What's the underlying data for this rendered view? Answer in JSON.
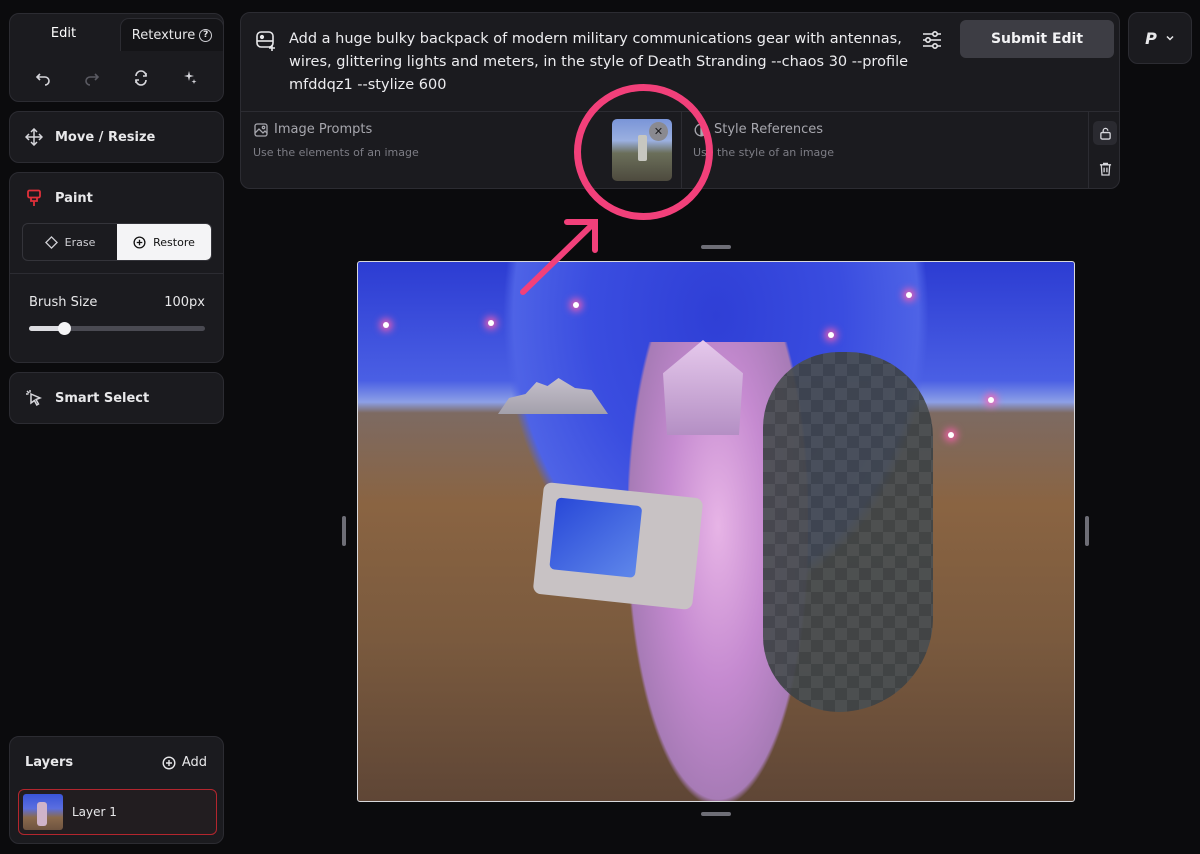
{
  "tabs": {
    "edit": "Edit",
    "retexture": "Retexture"
  },
  "tools": {
    "move": "Move / Resize",
    "paint": "Paint",
    "smart_select": "Smart Select"
  },
  "paint": {
    "erase": "Erase",
    "restore": "Restore",
    "brush_label": "Brush Size",
    "brush_value": "100px",
    "brush_fraction": 0.2
  },
  "layers": {
    "title": "Layers",
    "add": "Add",
    "items": [
      {
        "label": "Layer 1"
      }
    ]
  },
  "prompt": {
    "text": "Add a huge bulky backpack of modern military communications gear with antennas, wires, glittering lights and meters, in the style of Death Stranding --chaos 30 --profile mfddqz1 --stylize 600",
    "submit": "Submit Edit"
  },
  "image_prompts": {
    "title": "Image Prompts",
    "subtitle": "Use the elements of an image"
  },
  "style_references": {
    "title": "Style References",
    "subtitle": "Use the style of an image"
  },
  "profile": {
    "letter": "P"
  },
  "colors": {
    "accent": "#f2407a",
    "paint_icon": "#e0303a",
    "layer_border": "#b3262e"
  },
  "icons": [
    "undo-icon",
    "redo-icon",
    "refresh-icon",
    "sparkle-icon",
    "move-icon",
    "paint-icon",
    "eraser-icon",
    "plus-circle-icon",
    "cursor-select-icon",
    "settings-sliders-icon",
    "image-icon",
    "style-icon",
    "lock-icon",
    "trash-icon",
    "chevron-down-icon",
    "close-icon",
    "help-icon"
  ]
}
